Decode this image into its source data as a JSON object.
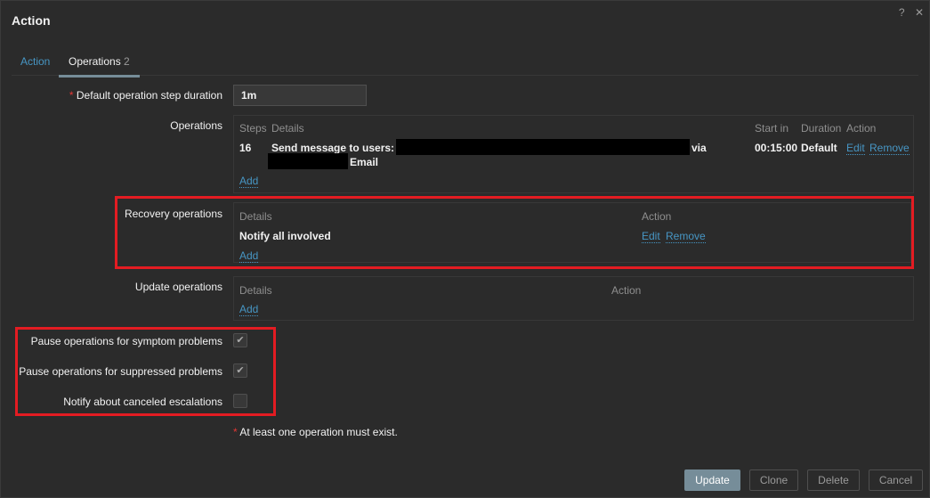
{
  "dialog": {
    "title": "Action",
    "help": "?",
    "close": "✕"
  },
  "tabs": [
    {
      "label": "Action"
    },
    {
      "label": "Operations",
      "count": "2"
    }
  ],
  "form": {
    "step_duration": {
      "label": "Default operation step duration",
      "value": "1m",
      "required": "*"
    },
    "operations": {
      "label": "Operations",
      "headers": [
        "Steps",
        "Details",
        "Start in",
        "Duration",
        "Action"
      ],
      "rows": [
        {
          "steps": "16",
          "details_prefix": "Send message to users:",
          "via": "via",
          "media": "Email",
          "start_in": "00:15:00",
          "duration": "Default",
          "edit": "Edit",
          "remove": "Remove"
        }
      ],
      "add": "Add"
    },
    "recovery": {
      "label": "Recovery operations",
      "headers": [
        "Details",
        "Action"
      ],
      "rows": [
        {
          "details": "Notify all involved",
          "edit": "Edit",
          "remove": "Remove"
        }
      ],
      "add": "Add"
    },
    "update": {
      "label": "Update operations",
      "headers": [
        "Details",
        "Action"
      ],
      "add": "Add"
    },
    "checkboxes": [
      {
        "label": "Pause operations for symptom problems",
        "checked": true
      },
      {
        "label": "Pause operations for suppressed problems",
        "checked": true
      },
      {
        "label": "Notify about canceled escalations",
        "checked": false
      }
    ],
    "note": "At least one operation must exist."
  },
  "buttons": {
    "update": "Update",
    "clone": "Clone",
    "delete": "Delete",
    "cancel": "Cancel"
  }
}
